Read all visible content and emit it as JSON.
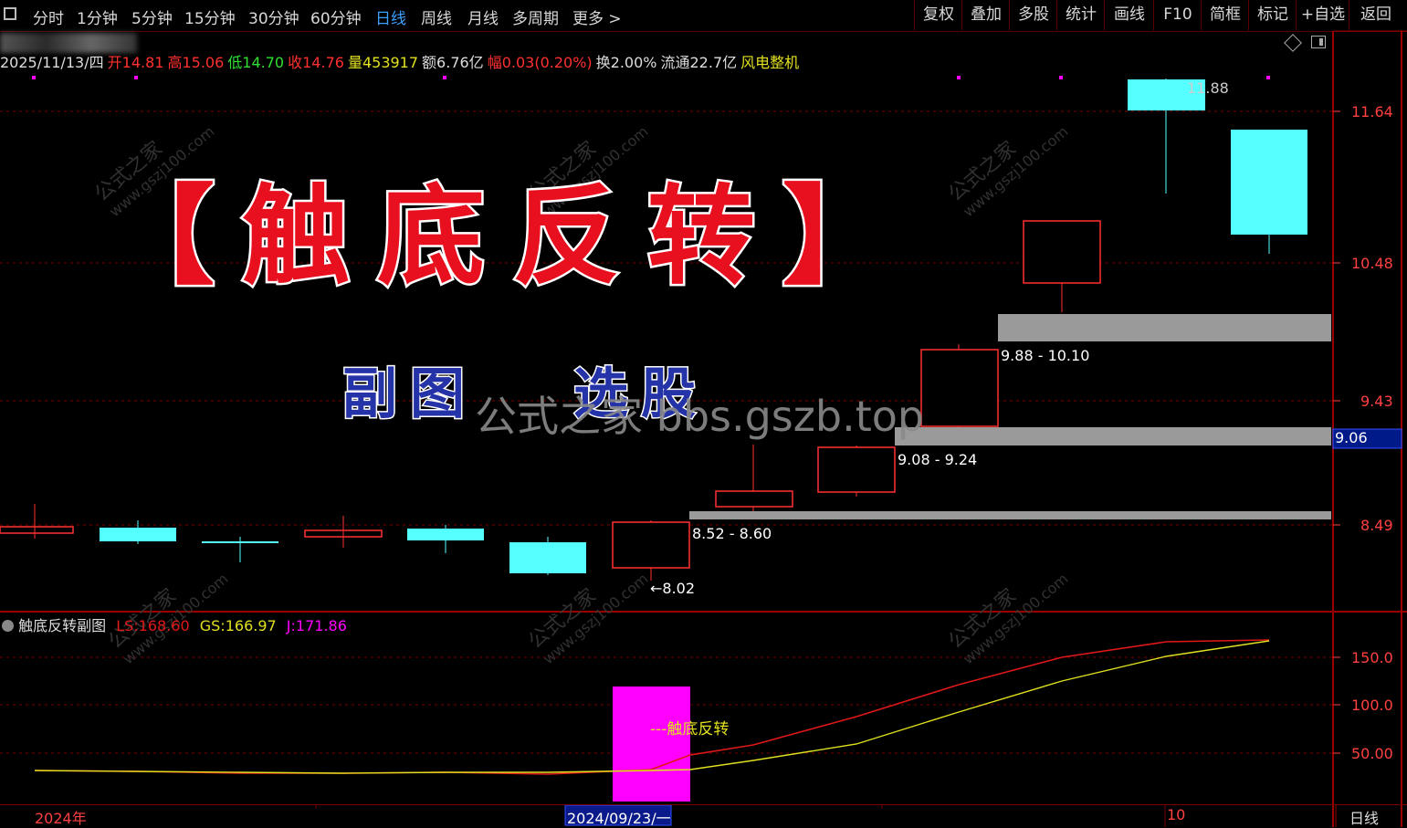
{
  "toolbar": {
    "left_items": [
      {
        "label": "分时"
      },
      {
        "label": "1分钟"
      },
      {
        "label": "5分钟"
      },
      {
        "label": "15分钟"
      },
      {
        "label": "30分钟"
      },
      {
        "label": "60分钟"
      },
      {
        "label": "日线",
        "active": true
      },
      {
        "label": "周线"
      },
      {
        "label": "月线"
      },
      {
        "label": "多周期"
      },
      {
        "label": "更多 >"
      }
    ],
    "right_items": [
      {
        "label": "复权"
      },
      {
        "label": "叠加"
      },
      {
        "label": "多股"
      },
      {
        "label": "统计"
      },
      {
        "label": "画线"
      },
      {
        "label": "F10"
      },
      {
        "label": "简框"
      },
      {
        "label": "标记"
      },
      {
        "label": "+自选"
      },
      {
        "label": "返回"
      }
    ]
  },
  "info": {
    "date": "2025/11/13/四",
    "open_label": "开",
    "open": "14.81",
    "high_label": "高",
    "high": "15.06",
    "low_label": "低",
    "low": "14.70",
    "close_label": "收",
    "close": "14.76",
    "volume_label": "量",
    "volume": "453917",
    "amount_label": "额",
    "amount": "6.76亿",
    "change_label": "幅",
    "change": "0.03(0.20%)",
    "turnover_label": "换",
    "turnover": "2.00%",
    "float_label": "流通",
    "float": "22.7亿",
    "industry": "风电整机"
  },
  "price_axis": [
    "11.64",
    "10.48",
    "9.43",
    "8.49"
  ],
  "current_price": "9.06",
  "zones": [
    {
      "label": "8.52 - 8.60"
    },
    {
      "label": "9.08 - 9.24"
    },
    {
      "label": "9.88 - 10.10"
    }
  ],
  "low_marker": "←8.02",
  "high_marker": "11.88",
  "banner": {
    "title": "【触底反转】",
    "sub_left": "副图",
    "sub_right": "选股",
    "site": "公式之家 bbs.gszb.top"
  },
  "watermark": {
    "cn": "公式之家",
    "url": "www.gszj100.com"
  },
  "indicator": {
    "name": "触底反转副图",
    "ls_label": "LS:",
    "ls": "168.60",
    "gs_label": "GS:",
    "gs": "166.97",
    "j_label": "J:",
    "j": "171.86",
    "signal_label": "---触底反转",
    "axis": [
      "150.0",
      "100.0",
      "50.00"
    ]
  },
  "dates": {
    "d1": "2024年",
    "d2": "2024/09/23/一",
    "d3": "10",
    "period": "日线"
  },
  "colors": {
    "up": "#ff3030",
    "down": "#54ffff",
    "ls": "#e01818",
    "gs": "#e0e020",
    "signal": "#ff00ff",
    "grid": "#7a0000"
  }
}
